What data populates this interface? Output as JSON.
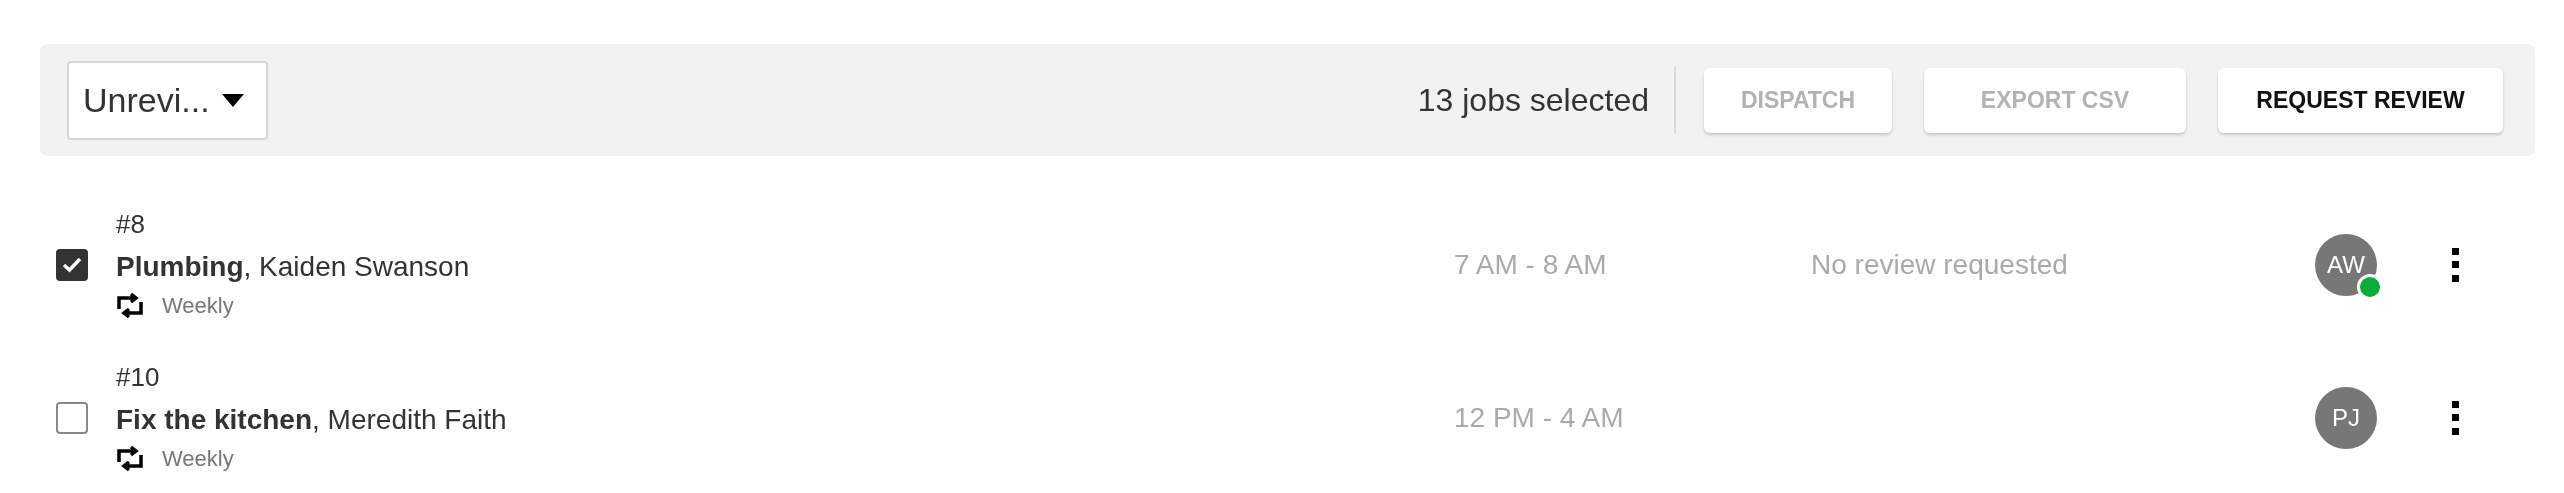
{
  "toolbar": {
    "filter": {
      "value": "Unrevi..."
    },
    "selection_count": "13 jobs selected",
    "buttons": [
      {
        "label": "DISPATCH",
        "disabled": true
      },
      {
        "label": "EXPORT CSV",
        "disabled": true
      },
      {
        "label": "REQUEST REVIEW",
        "disabled": false
      }
    ]
  },
  "jobs": [
    {
      "number": "#8",
      "title": "Plumbing",
      "customer": ", Kaiden Swanson",
      "recurrence": "Weekly",
      "checked": true,
      "time": "7 AM - 8 AM",
      "review_status": "No review requested",
      "assignee": "AW",
      "online": true
    },
    {
      "number": "#10",
      "title": "Fix the kitchen",
      "customer": ", Meredith Faith",
      "recurrence": "Weekly",
      "checked": false,
      "time": "12 PM - 4 AM",
      "assignee": "PJ",
      "online": false
    }
  ]
}
